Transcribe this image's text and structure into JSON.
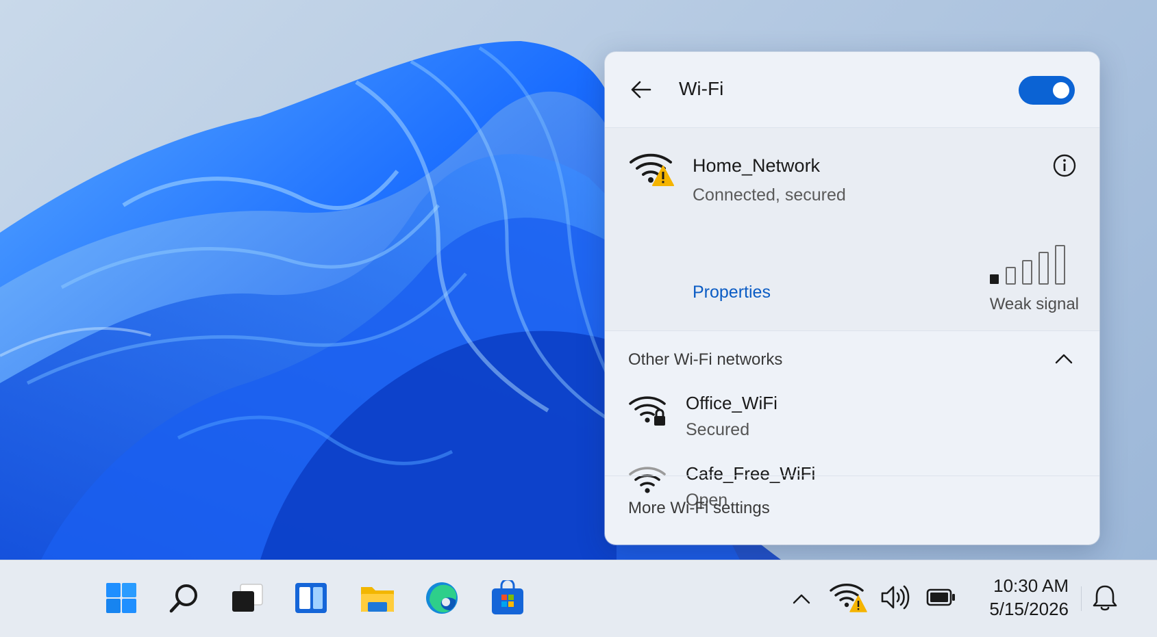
{
  "flyout": {
    "title": "Wi-Fi",
    "toggle_state": "on",
    "connected": {
      "name": "Home_Network",
      "status": "Connected, secured",
      "properties_label": "Properties",
      "signal_label": "Weak signal",
      "signal_strength": "1 of 5 bars",
      "warning_icon": "warning-icon"
    },
    "other_networks_label": "Other Wi-Fi networks",
    "networks": [
      {
        "name": "Office_WiFi",
        "status": "Secured",
        "icon": "wifi-locked-icon"
      },
      {
        "name": "Cafe_Free_WiFi",
        "status": "Open",
        "icon": "wifi-icon"
      }
    ],
    "more_settings_label": "More Wi-Fi settings"
  },
  "taskbar": {
    "apps": [
      "start-icon",
      "search-icon",
      "task-view-icon",
      "widgets-icon",
      "file-explorer-icon",
      "edge-icon",
      "store-icon"
    ],
    "clock": {
      "time": "10:30 AM",
      "date": "5/15/2026"
    }
  },
  "colors": {
    "accent": "#0b63d4",
    "link": "#0b5cc4",
    "warning": "#f5b400"
  }
}
